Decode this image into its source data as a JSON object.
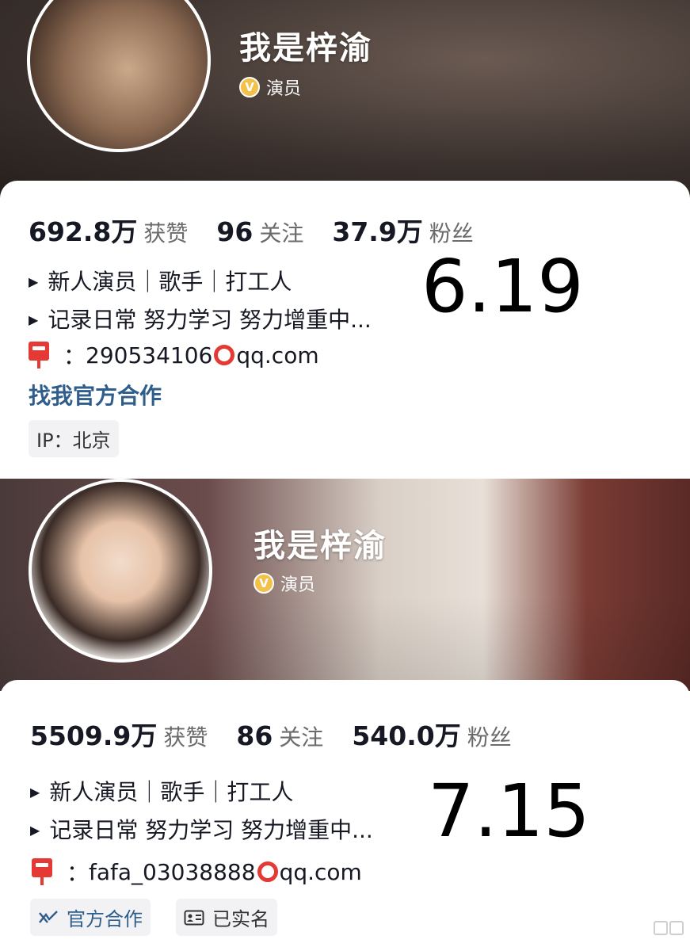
{
  "profiles": [
    {
      "name": "我是梓渝",
      "role": "演员",
      "stats": [
        {
          "value": "692.8万",
          "label": "获赞"
        },
        {
          "value": "96",
          "label": "关注"
        },
        {
          "value": "37.9万",
          "label": "粉丝"
        }
      ],
      "bio": [
        "新人演员｜歌手｜打工人",
        "记录日常 努力学习 努力增重中..."
      ],
      "mail_sep": "：",
      "mail_prefix": "290534106",
      "mail_suffix": "qq.com",
      "coop_link": "找我官方合作",
      "ip": "IP：北京",
      "date": "6.19"
    },
    {
      "name": "我是梓渝",
      "role": "演员",
      "stats": [
        {
          "value": "5509.9万",
          "label": "获赞"
        },
        {
          "value": "86",
          "label": "关注"
        },
        {
          "value": "540.0万",
          "label": "粉丝"
        }
      ],
      "bio": [
        "新人演员｜歌手｜打工人",
        "记录日常 努力学习 努力增重中..."
      ],
      "mail_sep": "：",
      "mail_prefix": "fafa_03038888 ",
      "mail_suffix": "qq.com",
      "tags": [
        "官方合作",
        "已实名"
      ],
      "date": "7.15"
    }
  ],
  "badge_letter": "V",
  "colors": {
    "accent_link": "#2f5e8c",
    "badge_gold": "#f3c04a",
    "mail_red": "#e53935"
  }
}
